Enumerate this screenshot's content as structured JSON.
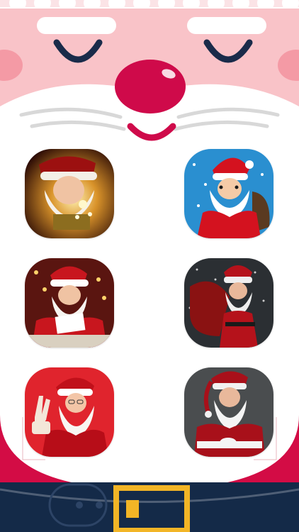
{
  "theme": {
    "skin": "#f9c3c8",
    "cheek": "#f49aa5",
    "nose": "#cf0a4a",
    "eye": "#1a2b4a",
    "beard_shadow": "#d8d8d8",
    "suit": "#d30c45",
    "belt": "#142a48",
    "buckle": "#f2b526",
    "pom": "#fbe3e6"
  },
  "face": {
    "left_eye": "closed-eye-icon",
    "right_eye": "closed-eye-icon",
    "nose": "round-nose-icon",
    "mouth": "smile-icon"
  },
  "video_tiles": [
    {
      "id": "santa-glowing-book",
      "icon": "santa-portrait-icon",
      "scene": "dark-gold"
    },
    {
      "id": "santa-cartoon-sack",
      "icon": "santa-portrait-icon",
      "scene": "blue-snow"
    },
    {
      "id": "santa-reading-letter",
      "icon": "santa-portrait-icon",
      "scene": "warm-room"
    },
    {
      "id": "santa-carrying-sack",
      "icon": "santa-portrait-icon",
      "scene": "dark-snow"
    },
    {
      "id": "santa-peace-sign",
      "icon": "santa-portrait-icon",
      "scene": "red-studio"
    },
    {
      "id": "santa-seated-gray",
      "icon": "santa-portrait-icon",
      "scene": "gray-studio"
    }
  ]
}
